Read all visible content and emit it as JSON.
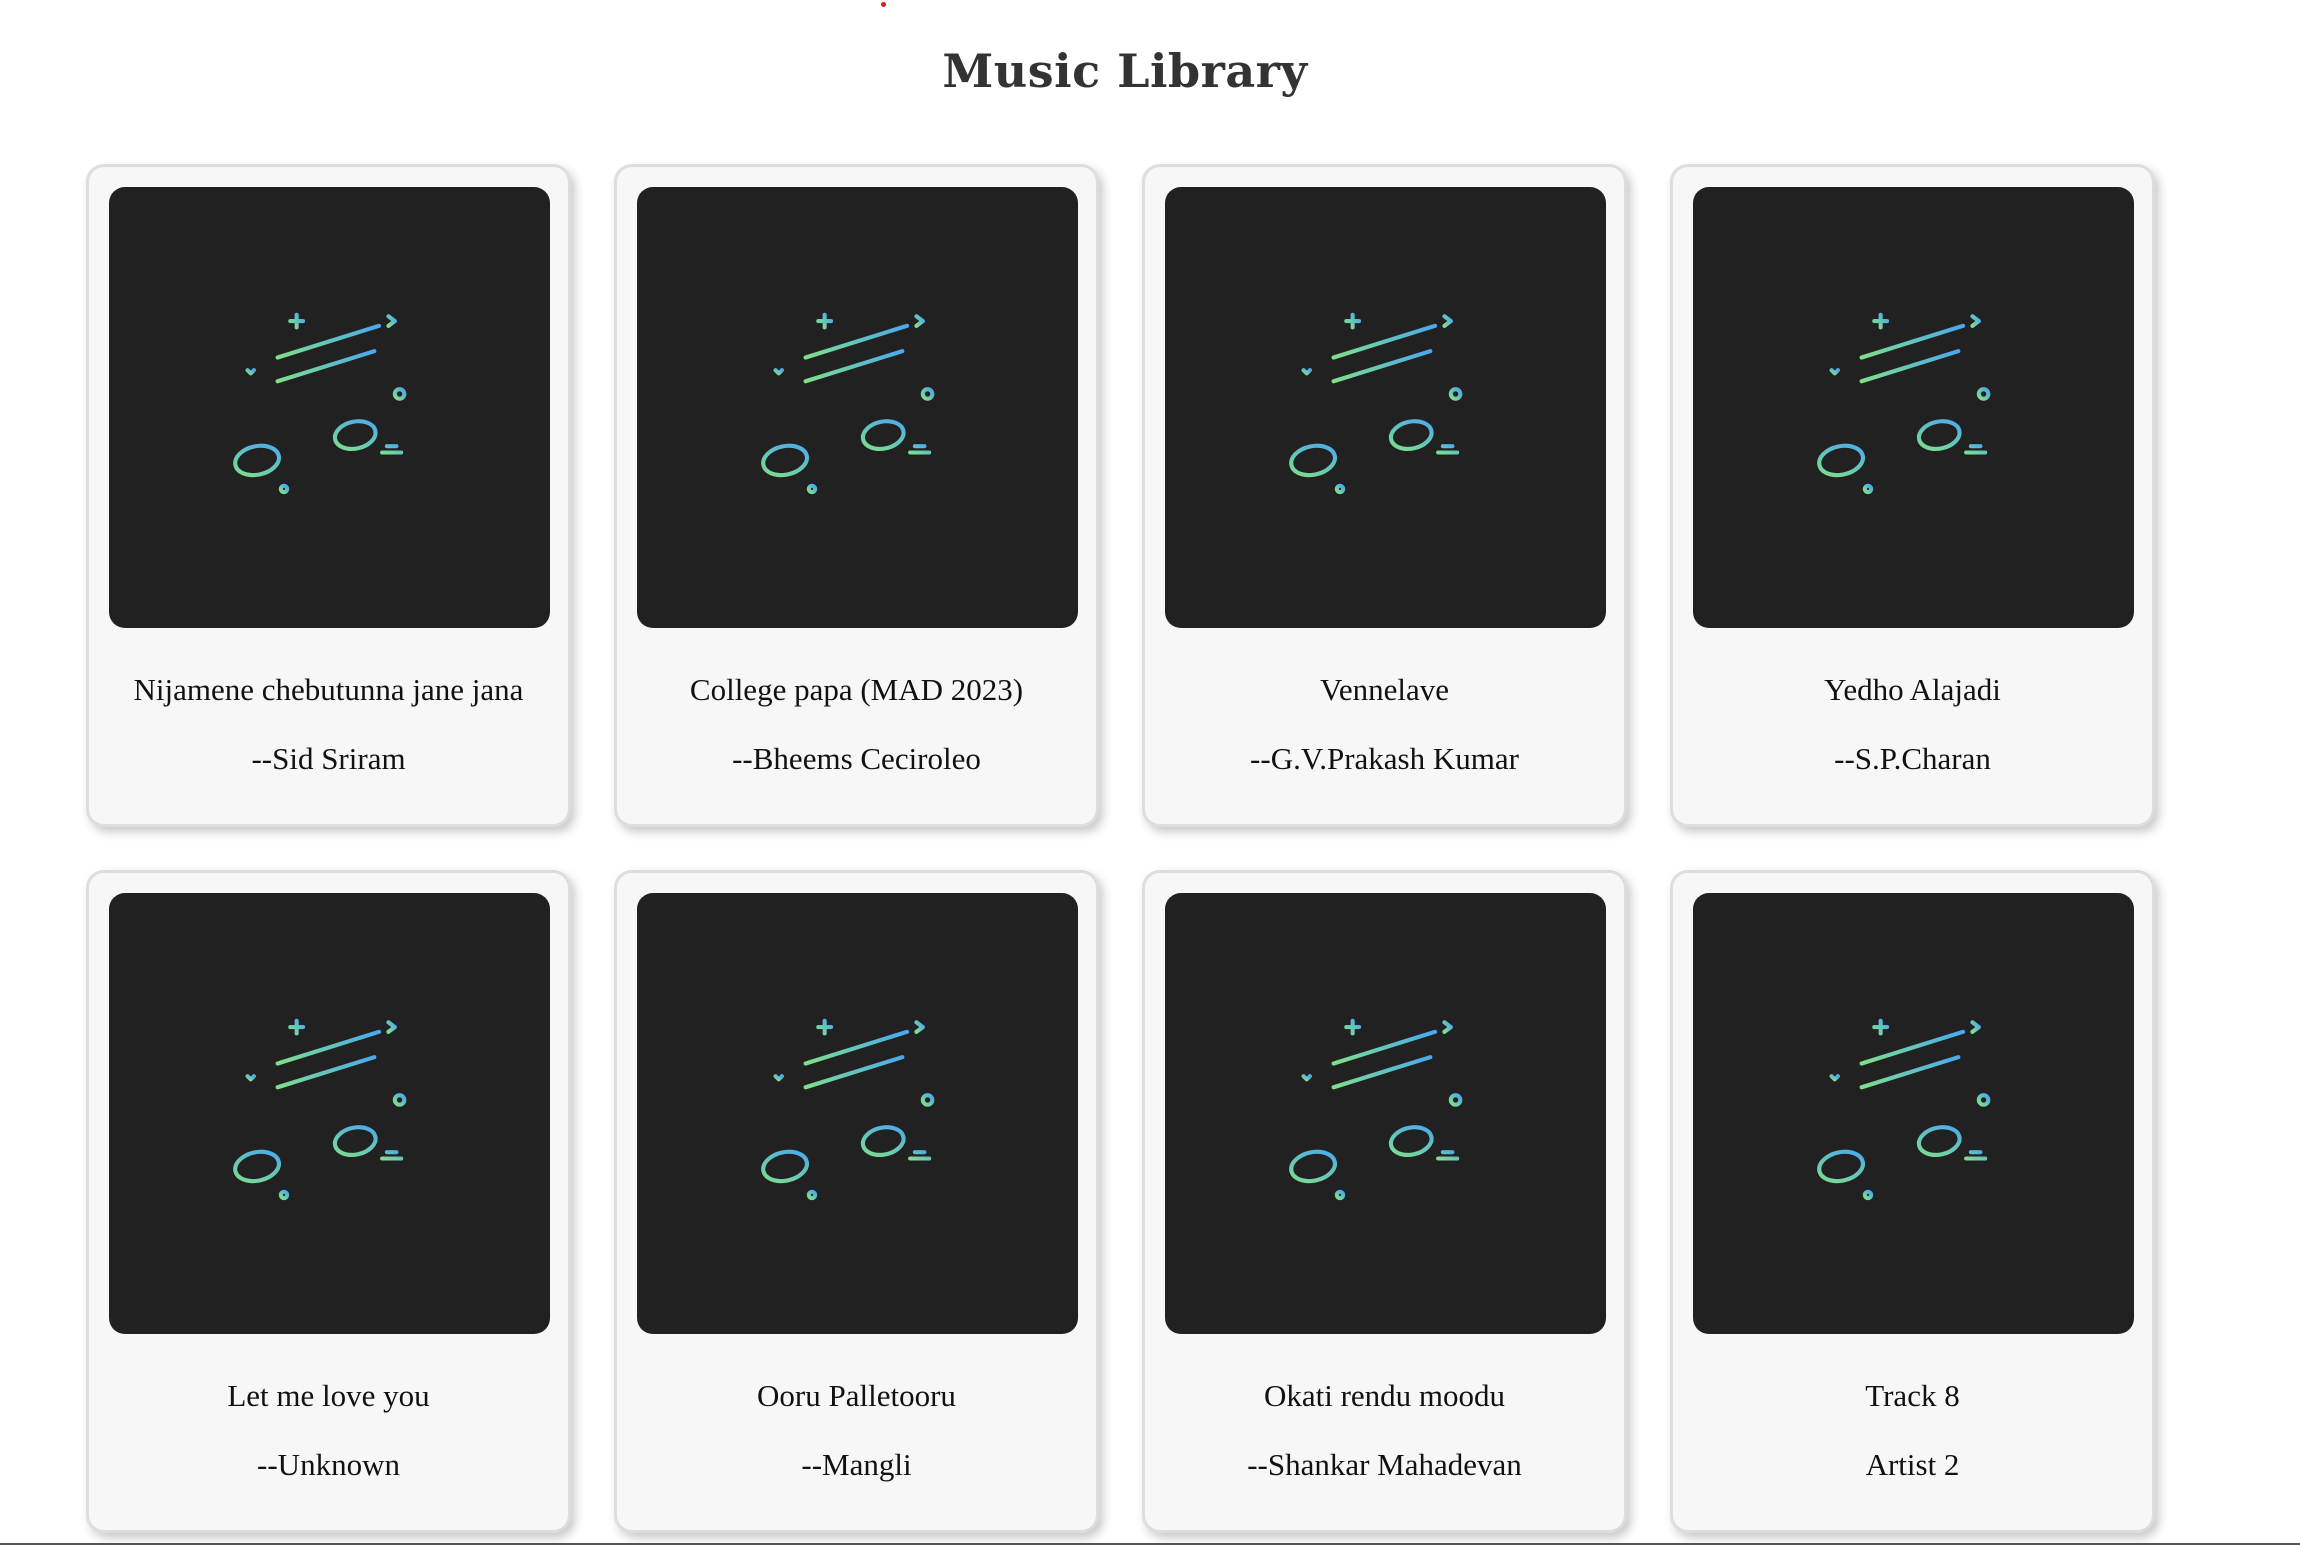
{
  "page": {
    "title": "Music Library"
  },
  "colors": {
    "card_background": "#f7f7f7",
    "card_border": "#dddddd",
    "cover_background": "#222122",
    "icon_gradient_start": "#7ee08a",
    "icon_gradient_end": "#4aa8f0",
    "title_text": "#333333"
  },
  "tracks": [
    {
      "title": "Nijamene chebutunna jane jana",
      "artist": "--Sid Sriram",
      "cover_icon": "music-note-icon"
    },
    {
      "title": "College papa (MAD 2023)",
      "artist": "--Bheems Ceciroleo",
      "cover_icon": "music-note-icon"
    },
    {
      "title": "Vennelave",
      "artist": "--G.V.Prakash Kumar",
      "cover_icon": "music-note-icon"
    },
    {
      "title": "Yedho Alajadi",
      "artist": "--S.P.Charan",
      "cover_icon": "music-note-icon"
    },
    {
      "title": "Let me love you",
      "artist": "--Unknown",
      "cover_icon": "music-note-icon"
    },
    {
      "title": "Ooru Palletooru",
      "artist": "--Mangli",
      "cover_icon": "music-note-icon"
    },
    {
      "title": "Okati rendu moodu",
      "artist": "--Shankar Mahadevan",
      "cover_icon": "music-note-icon"
    },
    {
      "title": "Track 8",
      "artist": "Artist 2",
      "cover_icon": "music-note-icon"
    }
  ]
}
